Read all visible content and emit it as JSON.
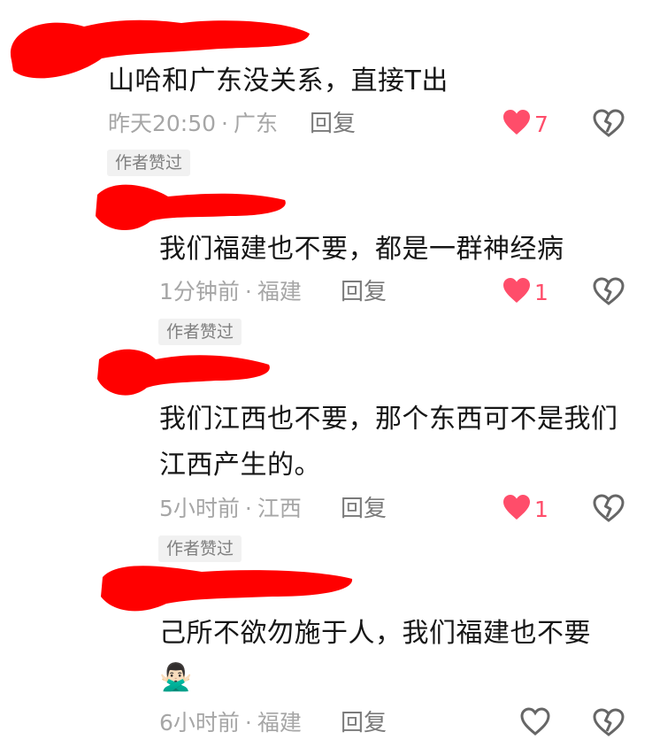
{
  "comments": [
    {
      "text": "山哈和广东没关系，直接T出",
      "time": "昨天20:50",
      "location": "广东",
      "reply_label": "回复",
      "like_count": "7",
      "liked": true,
      "badge": "作者赞过"
    },
    {
      "text": "我们福建也不要，都是一群神经病",
      "time": "1分钟前",
      "location": "福建",
      "reply_label": "回复",
      "like_count": "1",
      "liked": true,
      "badge": "作者赞过"
    },
    {
      "text_line1": "我们江西也不要，那个东西可不是我们",
      "text_line2": "江西产生的。",
      "time": "5小时前",
      "location": "江西",
      "reply_label": "回复",
      "like_count": "1",
      "liked": true,
      "badge": "作者赞过"
    },
    {
      "text": "己所不欲勿施于人，我们福建也不要",
      "emoji": "🙅🏻‍♂️",
      "time": "6小时前",
      "location": "福建",
      "reply_label": "回复",
      "like_count": "",
      "liked": false
    }
  ],
  "meta_separator": "·",
  "colors": {
    "redaction": "#ff0000",
    "like_active": "#ff4d6a",
    "meta_text": "#a6a6a6",
    "badge_bg": "#f1f1f1"
  },
  "icons": {
    "like": "heart-icon",
    "dislike": "broken-heart-icon"
  }
}
